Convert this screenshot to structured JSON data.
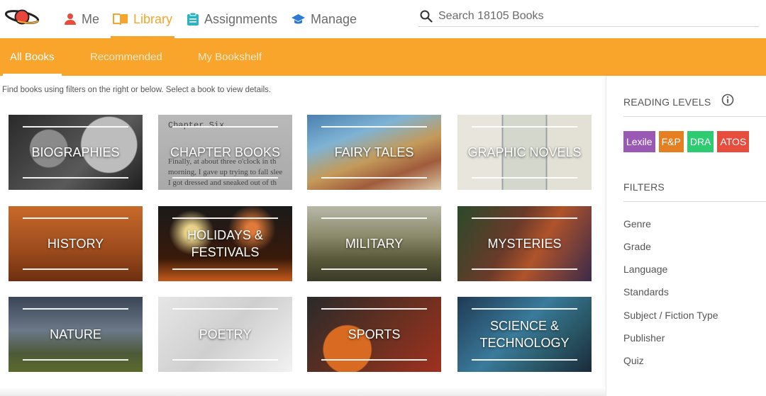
{
  "nav": {
    "items": [
      {
        "label": "Me",
        "icon": "person-icon"
      },
      {
        "label": "Library",
        "icon": "book-icon"
      },
      {
        "label": "Assignments",
        "icon": "clipboard-icon"
      },
      {
        "label": "Manage",
        "icon": "graduation-cap-icon"
      }
    ],
    "active": "Library",
    "search_placeholder": "Search 18105 Books"
  },
  "tabs": [
    {
      "label": "All Books"
    },
    {
      "label": "Recommended"
    },
    {
      "label": "My Bookshelf"
    }
  ],
  "hint": "Find books using filters on the right or below. Select a book to view details.",
  "categories": [
    {
      "label": "BIOGRAPHIES"
    },
    {
      "label": "CHAPTER BOOKS"
    },
    {
      "label": "FAIRY TALES"
    },
    {
      "label": "GRAPHIC NOVELS"
    },
    {
      "label": "HISTORY"
    },
    {
      "label": "HOLIDAYS & FESTIVALS"
    },
    {
      "label": "MILITARY"
    },
    {
      "label": "MYSTERIES"
    },
    {
      "label": "NATURE"
    },
    {
      "label": "POETRY"
    },
    {
      "label": "SPORTS"
    },
    {
      "label": "SCIENCE & TECHNOLOGY"
    }
  ],
  "chapter_tile_text": [
    "Chapter Six",
    "Finally, at about three o'clock in th",
    "morning, I gave up trying to fall slee",
    "I got dressed and sneaked out of th"
  ],
  "sidebar": {
    "reading_levels_title": "READING LEVELS",
    "levels": [
      {
        "label": "Lexile",
        "color": "#9b59b6"
      },
      {
        "label": "F&P",
        "color": "#e67e22"
      },
      {
        "label": "DRA",
        "color": "#2ecc71"
      },
      {
        "label": "ATOS",
        "color": "#e74c3c"
      }
    ],
    "filters_title": "FILTERS",
    "filters": [
      "Genre",
      "Grade",
      "Language",
      "Standards",
      "Subject / Fiction Type",
      "Publisher",
      "Quiz"
    ]
  },
  "colors": {
    "brand_orange": "#f9a42b",
    "active_orange": "#f7a42b"
  }
}
